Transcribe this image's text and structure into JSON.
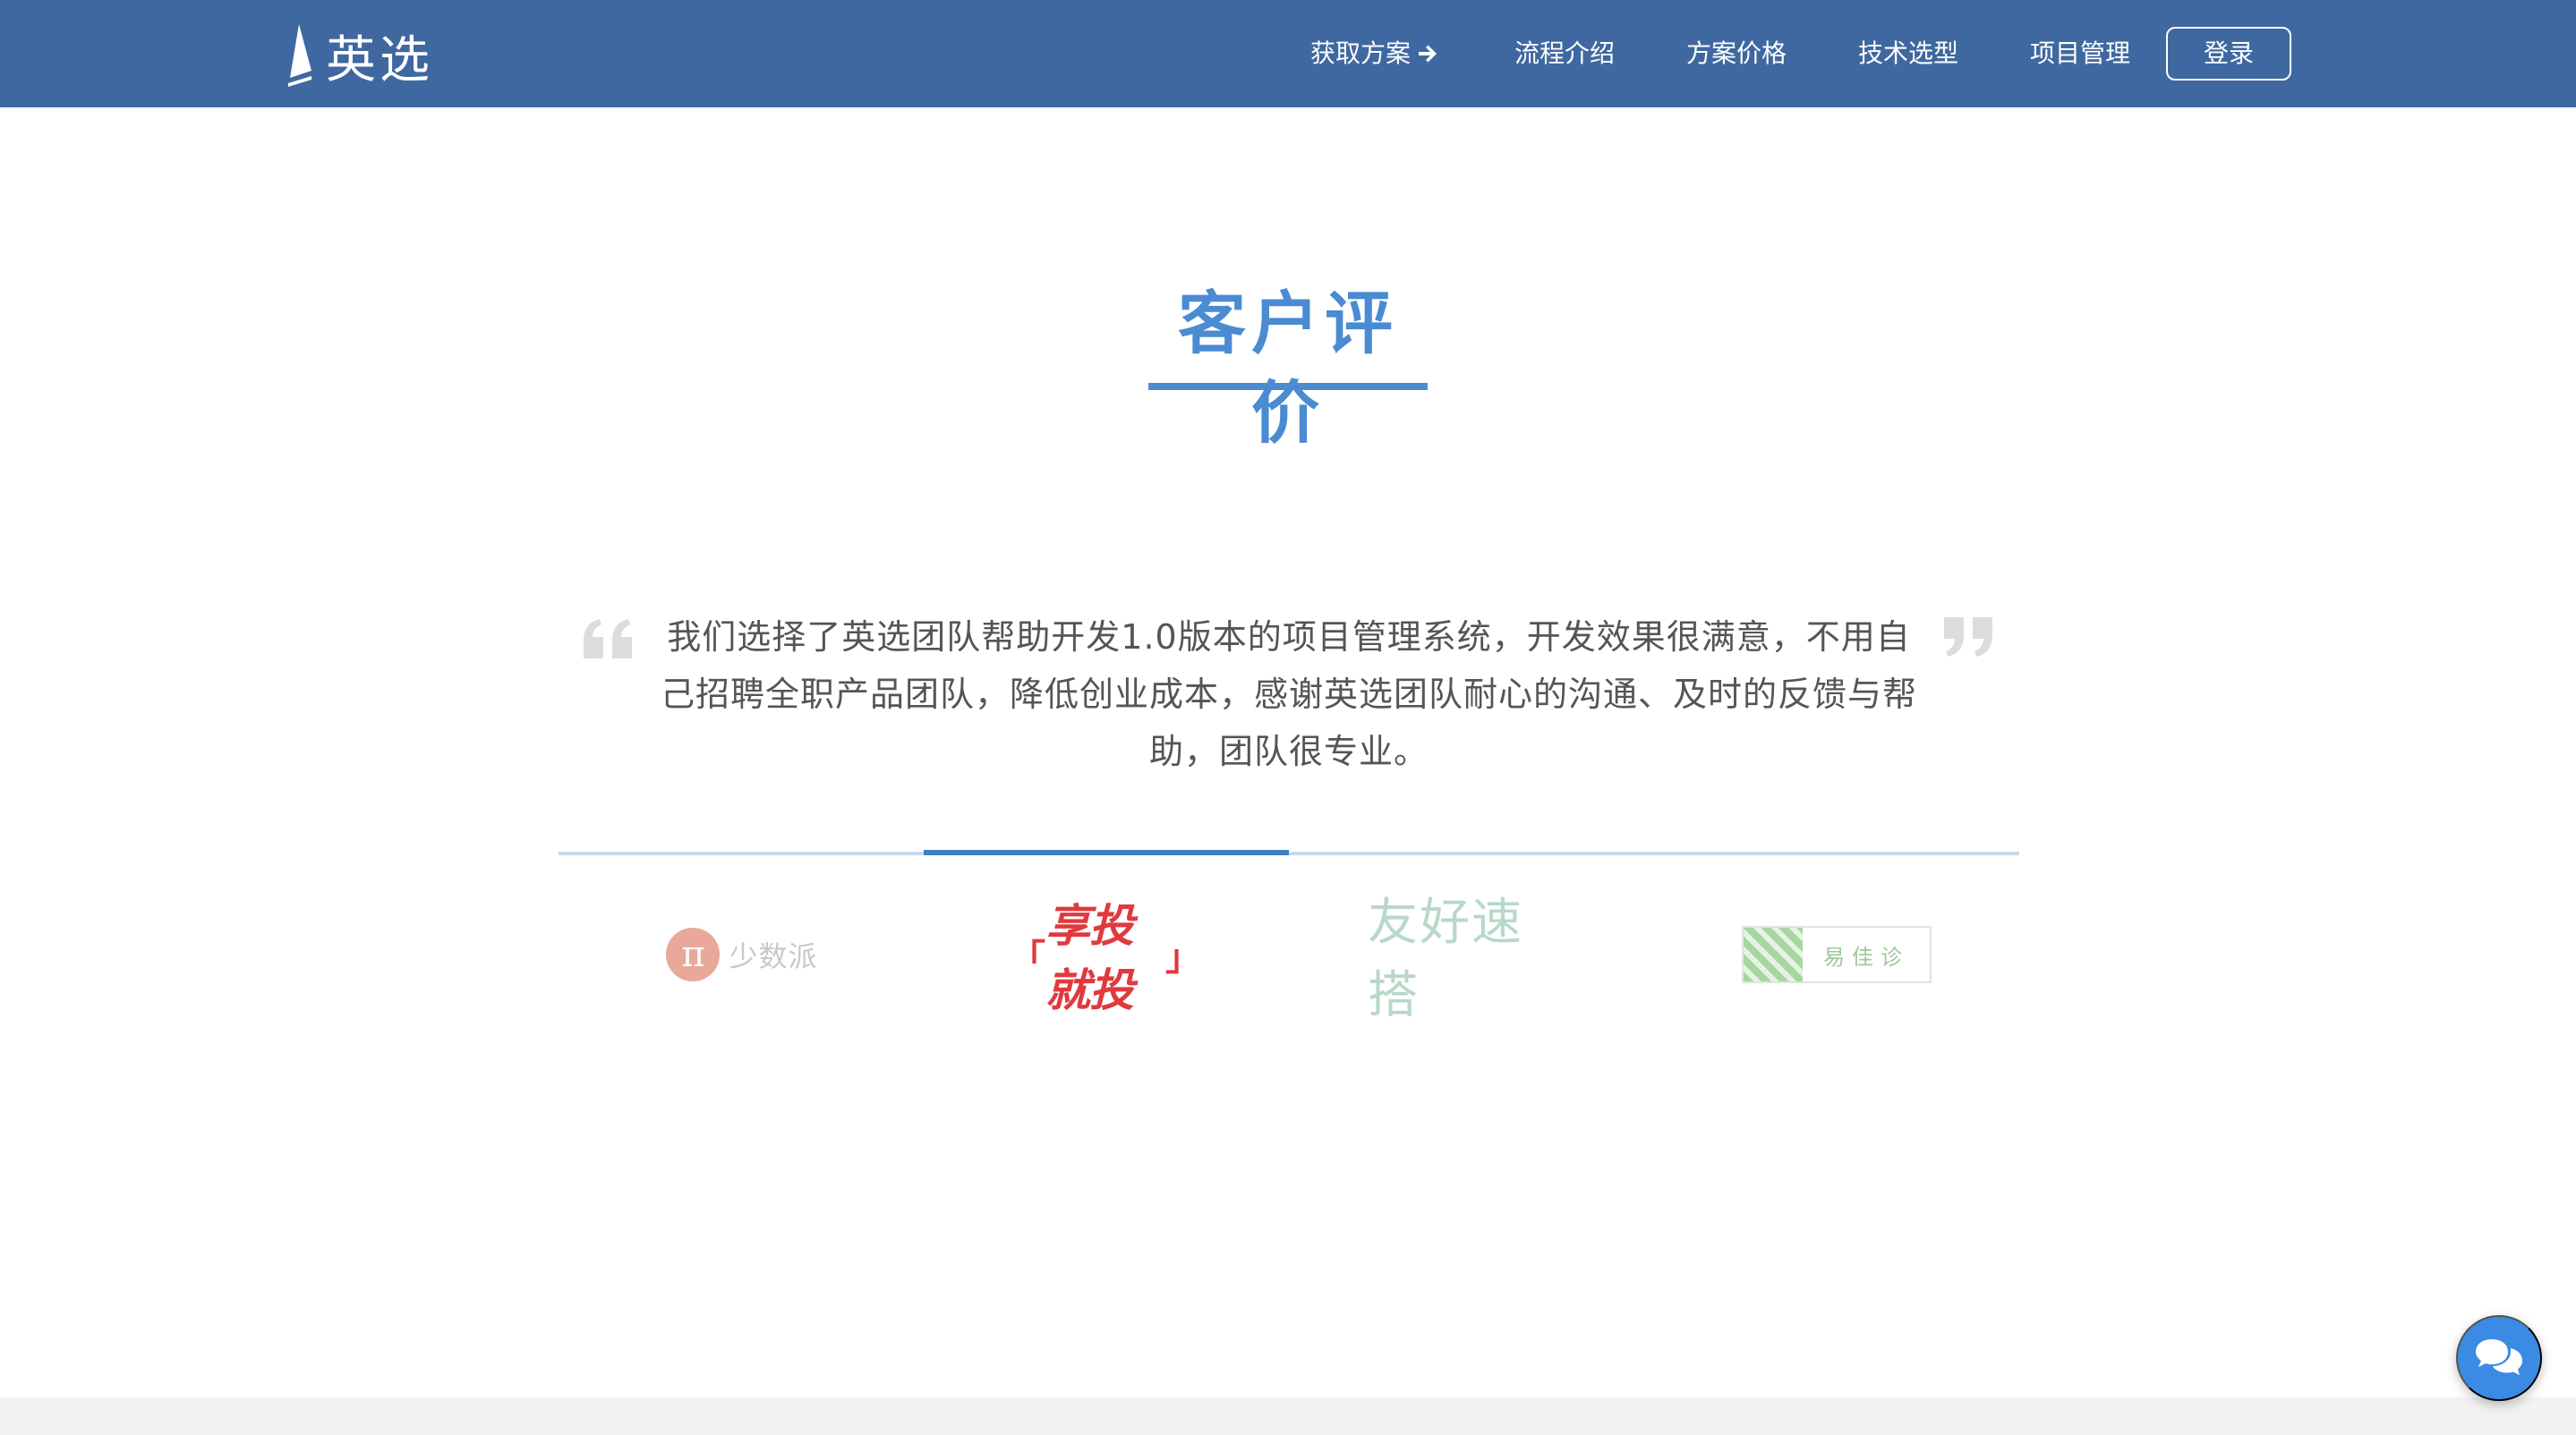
{
  "header": {
    "brand": "英选",
    "nav": [
      {
        "label": "获取方案",
        "icon": "arrow-right-icon"
      },
      {
        "label": "流程介绍"
      },
      {
        "label": "方案价格"
      },
      {
        "label": "技术选型"
      },
      {
        "label": "项目管理"
      }
    ],
    "login_label": "登录"
  },
  "section": {
    "title": "客户评价"
  },
  "testimonial": {
    "text": "我们选择了英选团队帮助开发1.0版本的项目管理系统，开发效果很满意，不用自己招聘全职产品团队，降低创业成本，感谢英选团队耐心的沟通、及时的反馈与帮助，团队很专业。",
    "active_index": 2,
    "total": 4
  },
  "clients": [
    {
      "name": "少数派",
      "mark": "π"
    },
    {
      "name": "享投就投",
      "bracket_open": "「",
      "bracket_close": "」"
    },
    {
      "name": "友好速搭"
    },
    {
      "name": "易佳诊"
    }
  ],
  "colors": {
    "nav_bg": "#3f68a1",
    "accent": "#4a8bd2",
    "chat_fab": "#3b8be4"
  }
}
